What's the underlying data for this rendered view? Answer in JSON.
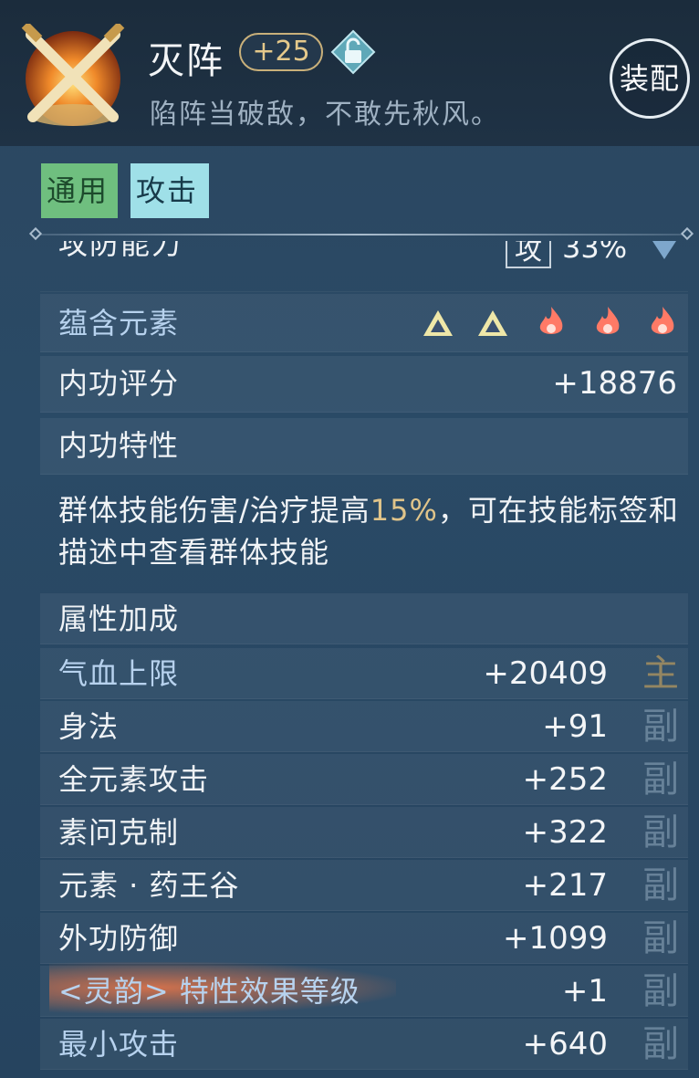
{
  "header": {
    "title": "灭阵",
    "level_badge": "+25",
    "flavor_text": "陷阵当破敌，不敢先秋风。",
    "equip_button": "装配"
  },
  "tabs": [
    {
      "label": "通用",
      "color": "#6fbf7f"
    },
    {
      "label": "攻击",
      "color": "#9fe0e8"
    }
  ],
  "attack_defense": {
    "label": "攻防能力",
    "type_box": "攻",
    "percent": "33%"
  },
  "elements": {
    "label": "蕴含元素",
    "icons": [
      "triangle-element-icon",
      "triangle-element-icon",
      "flame-element-icon",
      "flame-element-icon",
      "flame-element-icon"
    ]
  },
  "inner_score": {
    "label": "内功评分",
    "value": "+18876"
  },
  "trait": {
    "label": "内功特性",
    "text_before": "群体技能伤害/治疗提高",
    "highlight": "15%",
    "text_after": "，可在技能标签和描述中查看群体技能"
  },
  "bonus_header": "属性加成",
  "stats": [
    {
      "label": "气血上限",
      "value": "+20409",
      "tag": "主"
    },
    {
      "label": "身法",
      "value": "+91",
      "tag": "副"
    },
    {
      "label": "全元素攻击",
      "value": "+252",
      "tag": "副"
    },
    {
      "label": "素问克制",
      "value": "+322",
      "tag": "副"
    },
    {
      "label": "元素 · 药王谷",
      "value": "+217",
      "tag": "副"
    },
    {
      "label": "外功防御",
      "value": "+1099",
      "tag": "副"
    },
    {
      "label": "<灵韵> 特性效果等级",
      "value": "+1",
      "tag": "副"
    },
    {
      "label": "最小攻击",
      "value": "+640",
      "tag": "副"
    }
  ]
}
